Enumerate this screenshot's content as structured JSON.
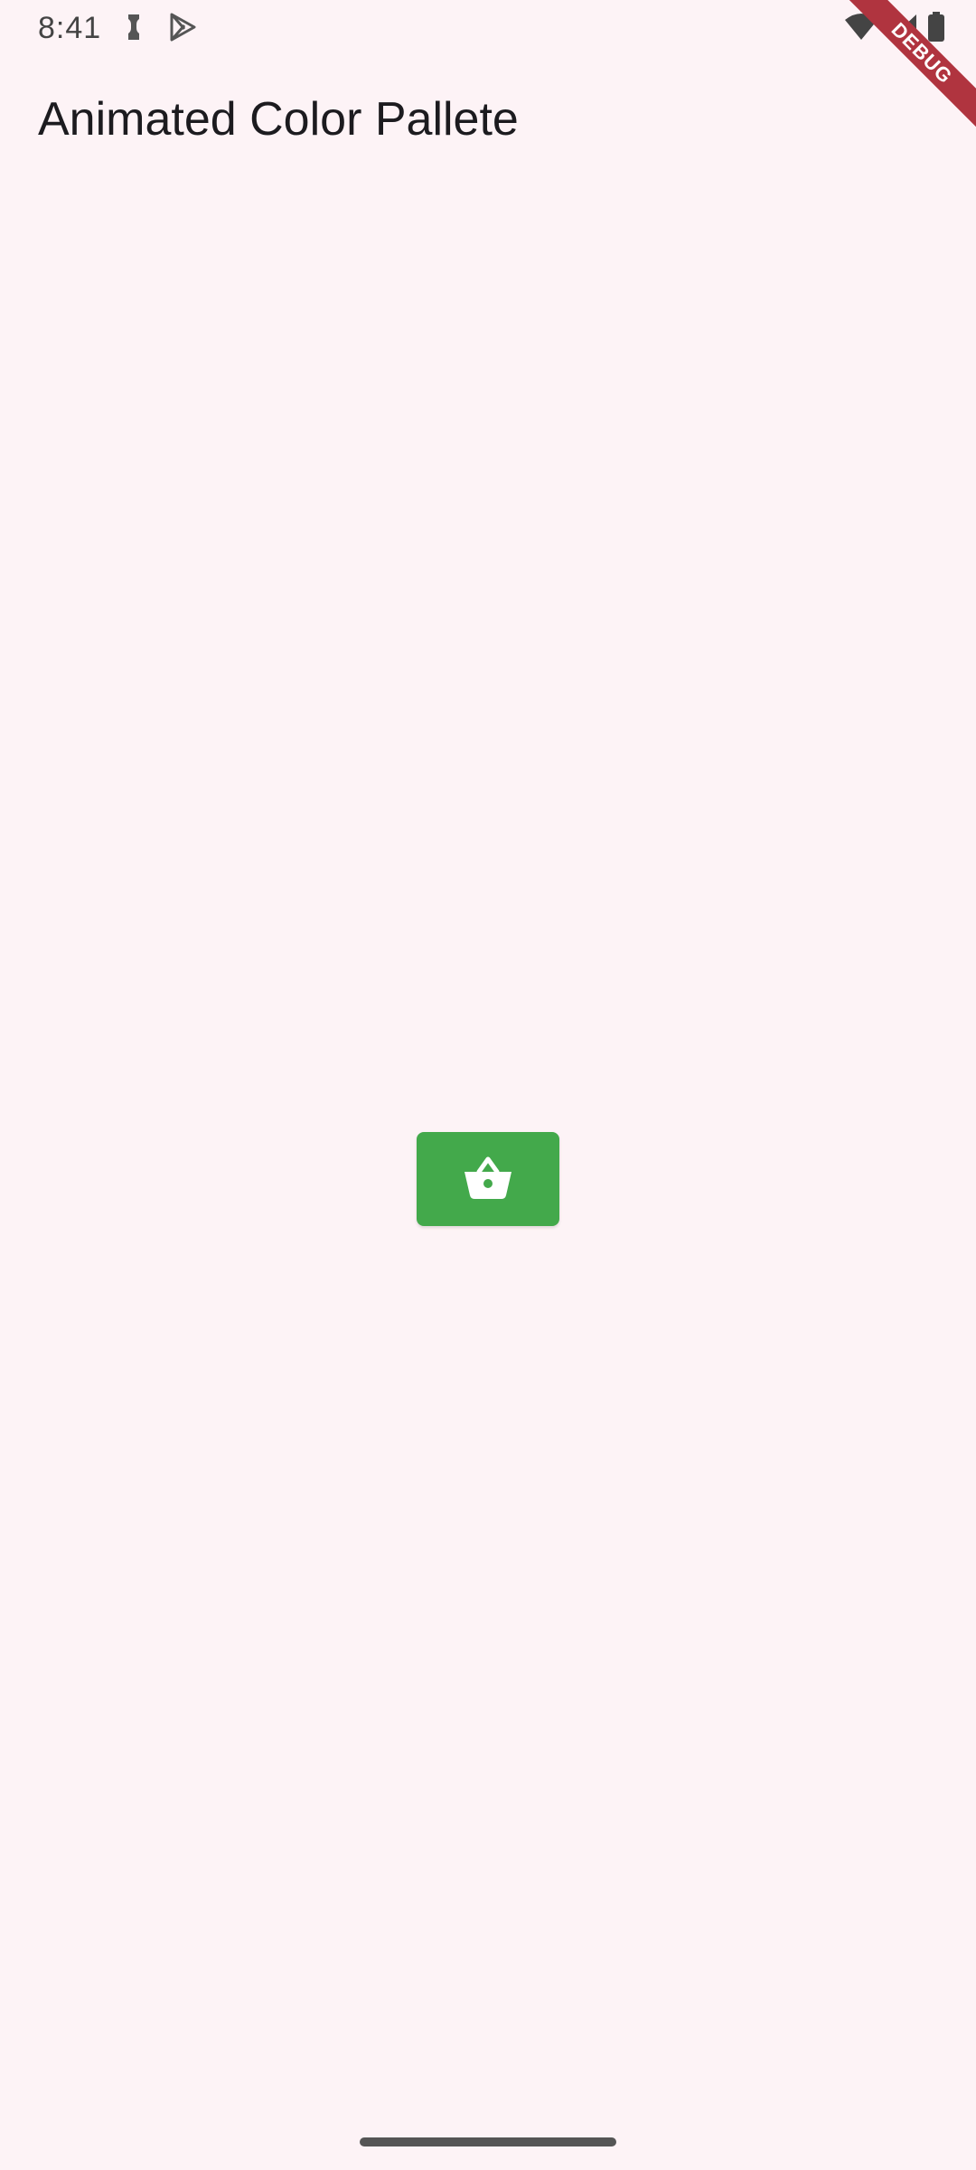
{
  "status_bar": {
    "time": "8:41",
    "icons": [
      "notification-icon",
      "play-store-icon",
      "wifi-icon",
      "signal-icon",
      "battery-icon"
    ]
  },
  "debug_banner": {
    "label": "DEBUG"
  },
  "app_bar": {
    "title": "Animated Color Pallete"
  },
  "main": {
    "button_icon": "shopping-basket-icon",
    "button_color": "#43a94b"
  },
  "theme": {
    "background": "#fdf3f6"
  }
}
